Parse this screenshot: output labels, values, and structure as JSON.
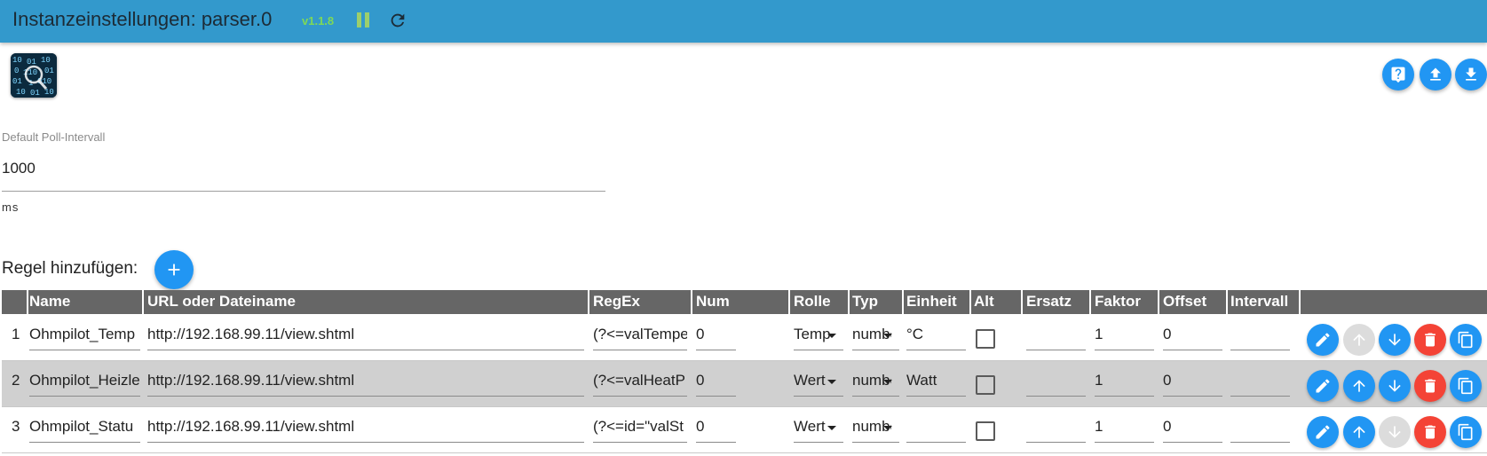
{
  "header": {
    "title": "Instanzeinstellungen: parser.0",
    "version": "v1.1.8"
  },
  "header_buttons": [
    "help-icon",
    "upload-icon",
    "download-icon"
  ],
  "poll": {
    "label": "Default Poll-Intervall",
    "value": "1000",
    "unit": "ms"
  },
  "add_rule": {
    "label": "Regel hinzufügen:"
  },
  "table": {
    "columns": [
      "Name",
      "URL oder Dateiname",
      "RegEx",
      "Num",
      "Rolle",
      "Typ",
      "Einheit",
      "Alt",
      "Ersatz",
      "Faktor",
      "Offset",
      "Intervall"
    ],
    "rows": [
      {
        "index": "1",
        "name": "Ohmpilot_Temp",
        "url": "http://192.168.99.11/view.shtml",
        "regex": "(?<=valTempe",
        "num": "0",
        "rolle": "Temper",
        "typ": "numbe",
        "einheit": "°C",
        "alt": false,
        "ersatz": "",
        "faktor": "1",
        "offset": "0",
        "intervall": "",
        "actions_enabled": {
          "edit": true,
          "up": false,
          "down": true,
          "delete": true,
          "copy": true
        }
      },
      {
        "index": "2",
        "name": "Ohmpilot_Heizle",
        "url": "http://192.168.99.11/view.shtml",
        "regex": "(?<=valHeatP",
        "num": "0",
        "rolle": "Wert",
        "typ": "numbe",
        "einheit": "Watt",
        "alt": false,
        "ersatz": "",
        "faktor": "1",
        "offset": "0",
        "intervall": "",
        "actions_enabled": {
          "edit": true,
          "up": true,
          "down": true,
          "delete": true,
          "copy": true
        }
      },
      {
        "index": "3",
        "name": "Ohmpilot_Statu",
        "url": "http://192.168.99.11/view.shtml",
        "regex": "(?<=id=\"valSt",
        "num": "0",
        "rolle": "Wert",
        "typ": "numbe",
        "einheit": "",
        "alt": false,
        "ersatz": "",
        "faktor": "1",
        "offset": "0",
        "intervall": "",
        "actions_enabled": {
          "edit": true,
          "up": true,
          "down": false,
          "delete": true,
          "copy": true
        }
      }
    ]
  },
  "colors": {
    "topbar": "#3399cc",
    "version": "#7ed957",
    "primary_button": "#2196f3",
    "delete_button": "#f44336",
    "disabled_button": "#dcdcdc",
    "table_header": "#666666",
    "row_alt": "#d0d0d0"
  }
}
